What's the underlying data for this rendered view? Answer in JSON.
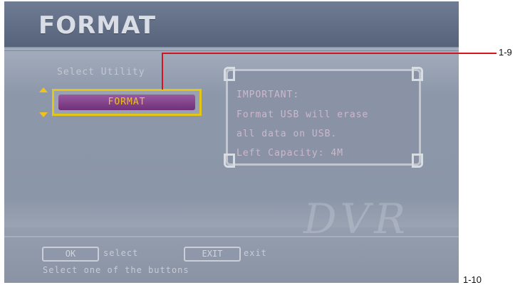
{
  "screen": {
    "title": "FORMAT",
    "section_label": "Select Utility",
    "format_button_label": "FORMAT",
    "info_lines": [
      "IMPORTANT:",
      "Format USB will erase",
      "all data on USB.",
      "Left Capacity: 4M"
    ],
    "watermark": "DVR",
    "footer": {
      "ok_key": "OK",
      "ok_label": "select",
      "exit_key": "EXIT",
      "exit_label": "exit",
      "hint": "Select one of the buttons"
    }
  },
  "callouts": {
    "top": "1-9",
    "bottom": "1-10"
  },
  "colors": {
    "accent_yellow": "#f1c21b",
    "button_purple": "#7b3585",
    "callout_red": "#d4151d"
  },
  "icons": {
    "up": "arrow-up-icon",
    "down": "arrow-down-icon"
  }
}
